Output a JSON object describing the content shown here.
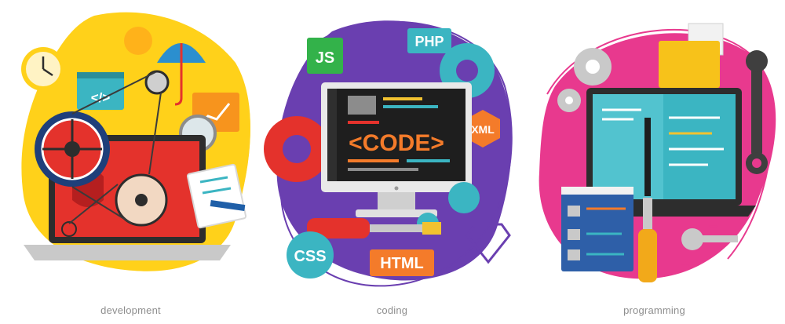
{
  "panels": [
    {
      "caption": "development",
      "code_tag": "</>"
    },
    {
      "caption": "coding",
      "screen_text": "<CODE>",
      "badges": {
        "js": "JS",
        "php": "PHP",
        "xml": "XML",
        "css": "CSS",
        "html": "HTML"
      }
    },
    {
      "caption": "programming"
    }
  ],
  "colors": {
    "yellow": "#FFD11A",
    "purple": "#6A3FB0",
    "pink": "#E8398E",
    "red": "#E4322C",
    "teal": "#3BB5C2",
    "orange": "#F47B2A",
    "navy": "#1F3F7A"
  }
}
